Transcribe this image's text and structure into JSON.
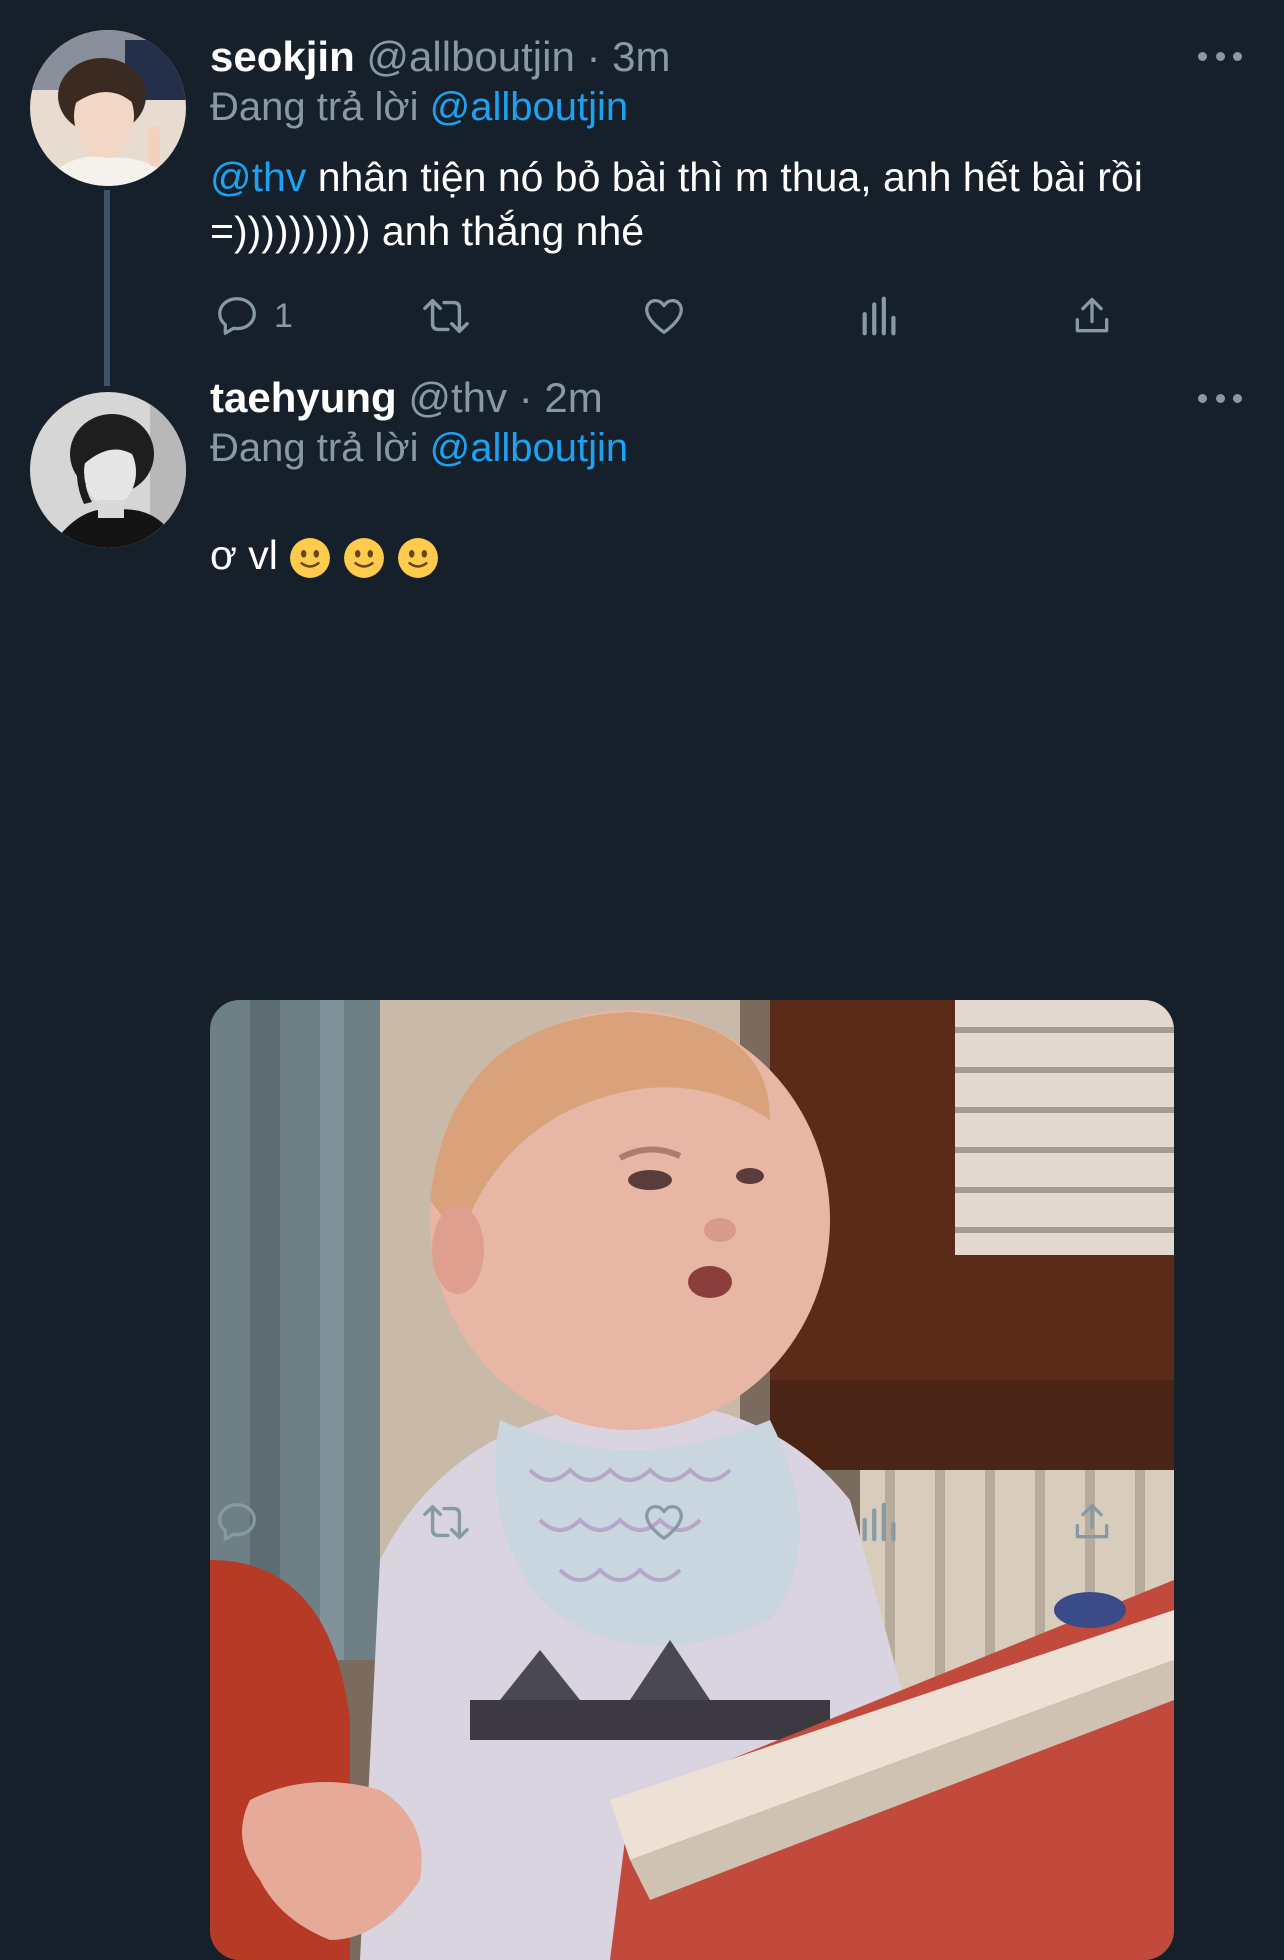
{
  "tweets": [
    {
      "display_name": "seokjin",
      "handle": "@allboutjin",
      "time": "· 3m",
      "replying_prefix": "Đang trả lời",
      "replying_to": "@allboutjin",
      "text_mention": "@thv",
      "text_rest": " nhân tiện nó bỏ bài thì m thua, anh hết bài rồi =)))))))))) anh thắng nhé",
      "reply_count": "1"
    },
    {
      "display_name": "taehyung",
      "handle": "@thv",
      "time": "· 2m",
      "replying_prefix": "Đang trả lời",
      "replying_to": "@allboutjin",
      "text": "ơ vl",
      "emojis": [
        "slightly-smiling-face",
        "slightly-smiling-face",
        "slightly-smiling-face"
      ],
      "reply_count": ""
    }
  ],
  "colors": {
    "background": "#15202b",
    "secondary_text": "#8899a6",
    "accent": "#1da1f2",
    "thread_line": "#3d5466"
  },
  "icons": {
    "reply": "reply-bubble-icon",
    "retweet": "retweet-icon",
    "like": "heart-icon",
    "analytics": "analytics-icon",
    "share": "share-icon",
    "more": "more-options-icon"
  }
}
